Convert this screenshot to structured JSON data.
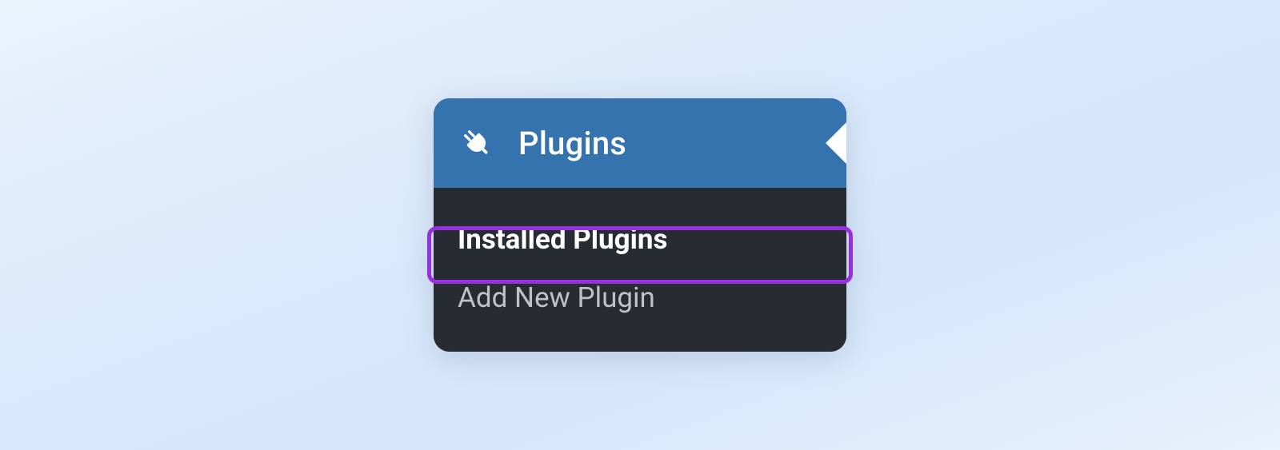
{
  "menu": {
    "header": {
      "label": "Plugins",
      "icon": "plug-icon"
    },
    "items": [
      {
        "label": "Installed Plugins",
        "active": true
      },
      {
        "label": "Add New Plugin",
        "active": false
      }
    ]
  },
  "colors": {
    "header_bg": "#3573af",
    "panel_bg": "#262c32",
    "highlight_border": "#9a2fe0"
  }
}
